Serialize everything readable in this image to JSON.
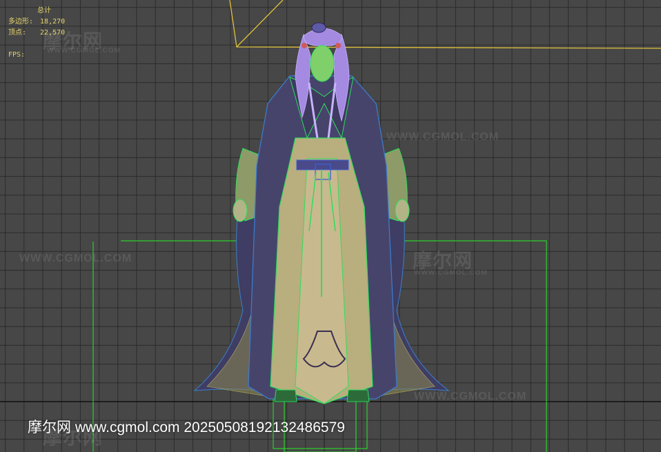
{
  "stats": {
    "title": "总计",
    "polygons_label": "多边形:",
    "polygons_value": "18,270",
    "vertices_label": "顶点:",
    "vertices_value": "22,570",
    "fps_label": "FPS:"
  },
  "watermarks": {
    "logo_text": "摩尔网",
    "site_caps": "WWW.CGMOL.COM",
    "footer": "摩尔网 www.cgmol.com 20250508192132486579"
  },
  "colors": {
    "background": "#474747",
    "grid_line": "#2b2b2b",
    "stats_text": "#e6d46a",
    "selection_box": "#29d22b",
    "camera_line": "#e0c23a",
    "model_wire_green": "#2be05a",
    "model_wire_yellow": "#e8e06a",
    "hair": "#a48ae0",
    "robe_dark": "#4a4670"
  }
}
